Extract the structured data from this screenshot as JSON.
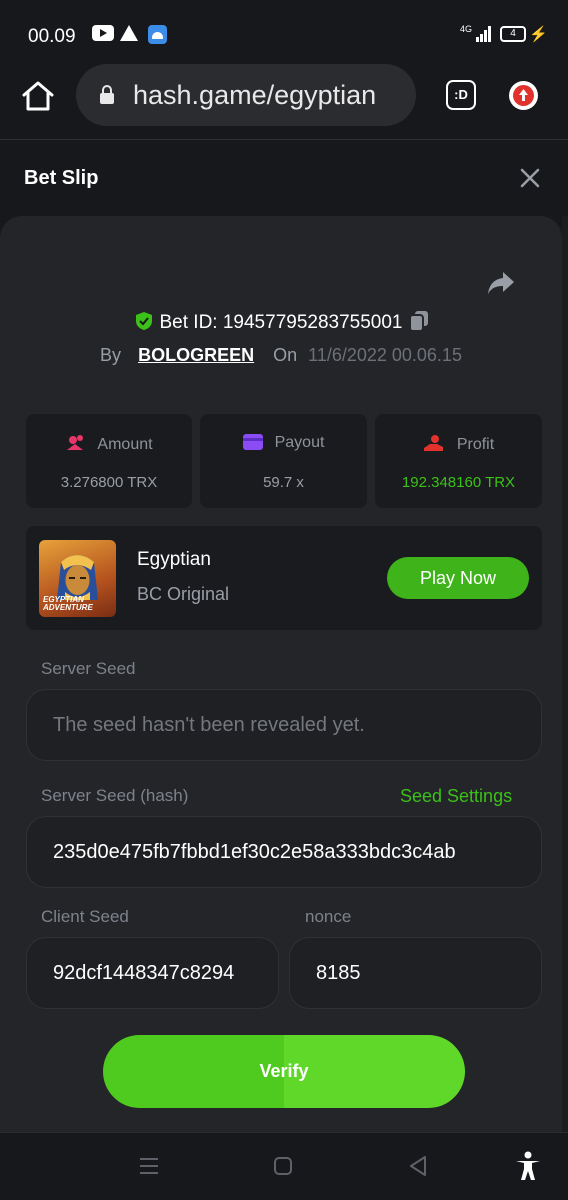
{
  "status_bar": {
    "time": "00.09",
    "network": "4G",
    "battery": "4"
  },
  "browser": {
    "url": "hash.game/egyptian",
    "tabs_label": ":D"
  },
  "bet_slip": {
    "title": "Bet Slip",
    "bet_id": "Bet ID: 19457795283755001",
    "by_label": "By",
    "username": "BOLOGREEN",
    "on_label": "On",
    "date": "11/6/2022 00.06.15"
  },
  "stats": {
    "amount_label": "Amount",
    "amount_value": "3.276800 TRX",
    "payout_label": "Payout",
    "payout_value": "59.7 x",
    "profit_label": "Profit",
    "profit_value": "192.348160 TRX"
  },
  "game": {
    "thumb_text_line1": "EGYPTIAN",
    "thumb_text_line2": "ADVENTURE",
    "name": "Egyptian",
    "provider": "BC Original",
    "play_label": "Play Now"
  },
  "seeds": {
    "server_seed_label": "Server Seed",
    "server_seed_placeholder": "The seed hasn't been revealed yet.",
    "server_seed_hash_label": "Server Seed (hash)",
    "seed_settings_label": "Seed Settings",
    "server_seed_hash_value": "235d0e475fb7fbbd1ef30c2e58a333bdc3c4ab",
    "client_seed_label": "Client Seed",
    "client_seed_value": "92dcf1448347c8294",
    "nonce_label": "nonce",
    "nonce_value": "8185"
  },
  "verify_label": "Verify",
  "colors": {
    "accent_green": "#3bc117",
    "background": "#17181b",
    "card": "#232529"
  }
}
